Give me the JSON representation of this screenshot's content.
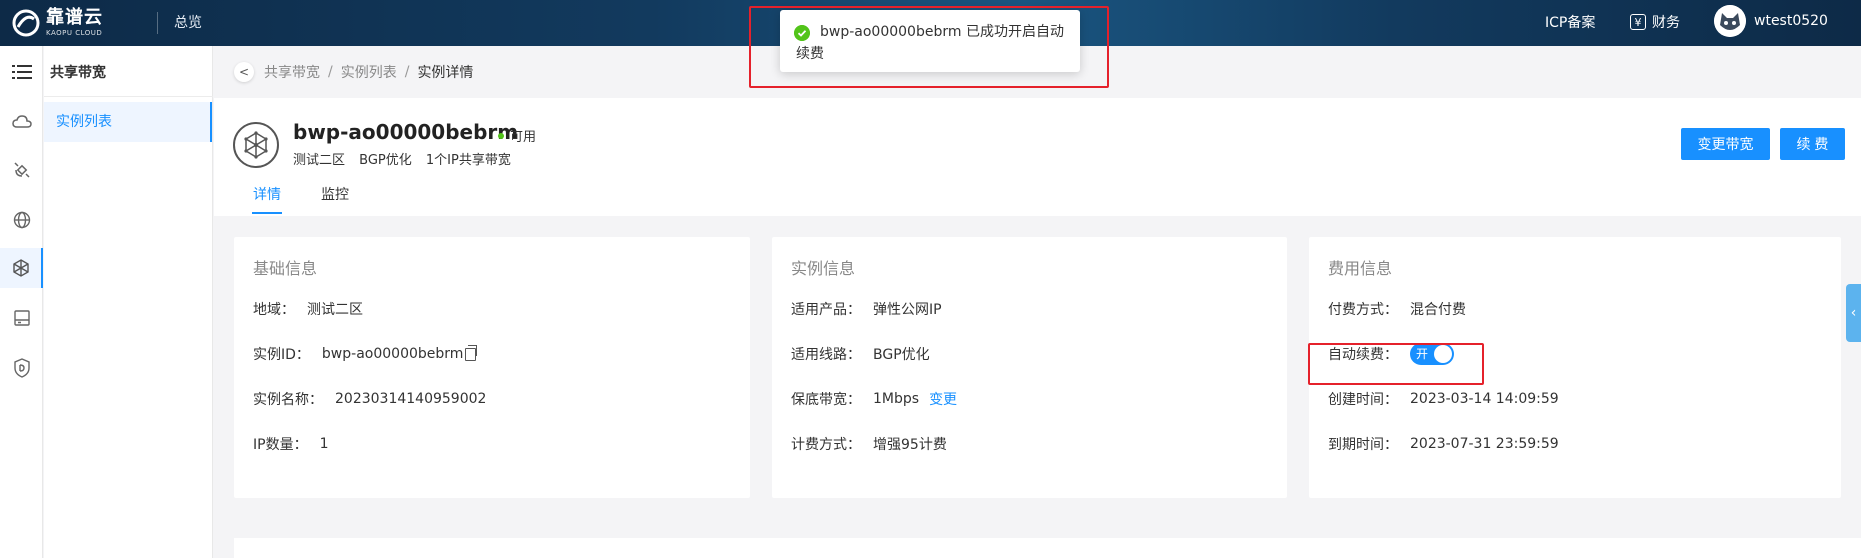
{
  "topbar": {
    "logo_cn": "靠谱云",
    "logo_en": "KAOPU CLOUD",
    "overview": "总览",
    "icp": "ICP备案",
    "finance": "财务",
    "yen_glyph": "¥",
    "username": "wtest0520"
  },
  "toast": {
    "line1": "bwp-ao00000bebrm 已成功开启自动",
    "line2": "续费",
    "icon": "check-circle-icon"
  },
  "iconbar": {
    "items": [
      "menu-icon",
      "cloud-icon",
      "satellite-icon",
      "globe-icon",
      "network-hub-icon",
      "storage-icon",
      "shield-icon"
    ],
    "active_index": 4
  },
  "subnav": {
    "title": "共享带宽",
    "items": [
      {
        "label": "实例列表",
        "active": true
      }
    ]
  },
  "breadcrumb": {
    "back_glyph": "<",
    "items": [
      "共享带宽",
      "实例列表",
      "实例详情"
    ],
    "separator": "/"
  },
  "instance": {
    "name": "bwp-ao00000bebrm",
    "status": "可用",
    "region": "测试二区",
    "line": "BGP优化",
    "desc": "1个IP共享带宽",
    "tabs": [
      "详情",
      "监控"
    ],
    "buttons": {
      "change_bandwidth": "变更带宽",
      "renew": "续 费"
    }
  },
  "cards": {
    "basic": {
      "title": "基础信息",
      "region_label": "地域：",
      "region_value": "测试二区",
      "id_label": "实例ID：",
      "id_value": "bwp-ao00000bebrm",
      "name_label": "实例名称：",
      "name_value": "20230314140959002",
      "ipcount_label": "IP数量：",
      "ipcount_value": "1"
    },
    "instance": {
      "title": "实例信息",
      "product_label": "适用产品：",
      "product_value": "弹性公网IP",
      "line_label": "适用线路：",
      "line_value": "BGP优化",
      "bw_label": "保底带宽：",
      "bw_value": "1Mbps",
      "bw_link": "变更",
      "billing_label": "计费方式：",
      "billing_value": "增强95计费"
    },
    "fee": {
      "title": "费用信息",
      "pay_label": "付费方式：",
      "pay_value": "混合付费",
      "auto_label": "自动续费：",
      "auto_toggle": "开",
      "created_label": "创建时间：",
      "created_value": "2023-03-14 14:09:59",
      "expire_label": "到期时间：",
      "expire_value": "2023-07-31 23:59:59"
    }
  },
  "colors": {
    "primary": "#1890ff",
    "success": "#52c41a",
    "highlight": "#e5212b",
    "topbar": "#0d2a47"
  },
  "edge_tab_glyph": "‹"
}
